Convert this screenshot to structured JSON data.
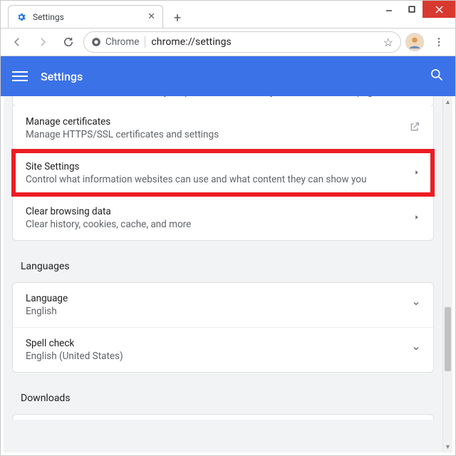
{
  "window": {
    "tab_title": "Settings",
    "url_chip": "Chrome",
    "url": "chrome://settings"
  },
  "appbar": {
    "title": "Settings"
  },
  "privacy": {
    "cookies_cutoff": "Uses cookies to remember your preferences, even if you don't visit those pages",
    "certs": {
      "title": "Manage certificates",
      "desc": "Manage HTTPS/SSL certificates and settings"
    },
    "site": {
      "title": "Site Settings",
      "desc": "Control what information websites can use and what content they can show you"
    },
    "clear": {
      "title": "Clear browsing data",
      "desc": "Clear history, cookies, cache, and more"
    }
  },
  "sections": {
    "languages": "Languages",
    "downloads": "Downloads"
  },
  "languages": {
    "lang": {
      "title": "Language",
      "value": "English"
    },
    "spell": {
      "title": "Spell check",
      "value": "English (United States)"
    }
  }
}
